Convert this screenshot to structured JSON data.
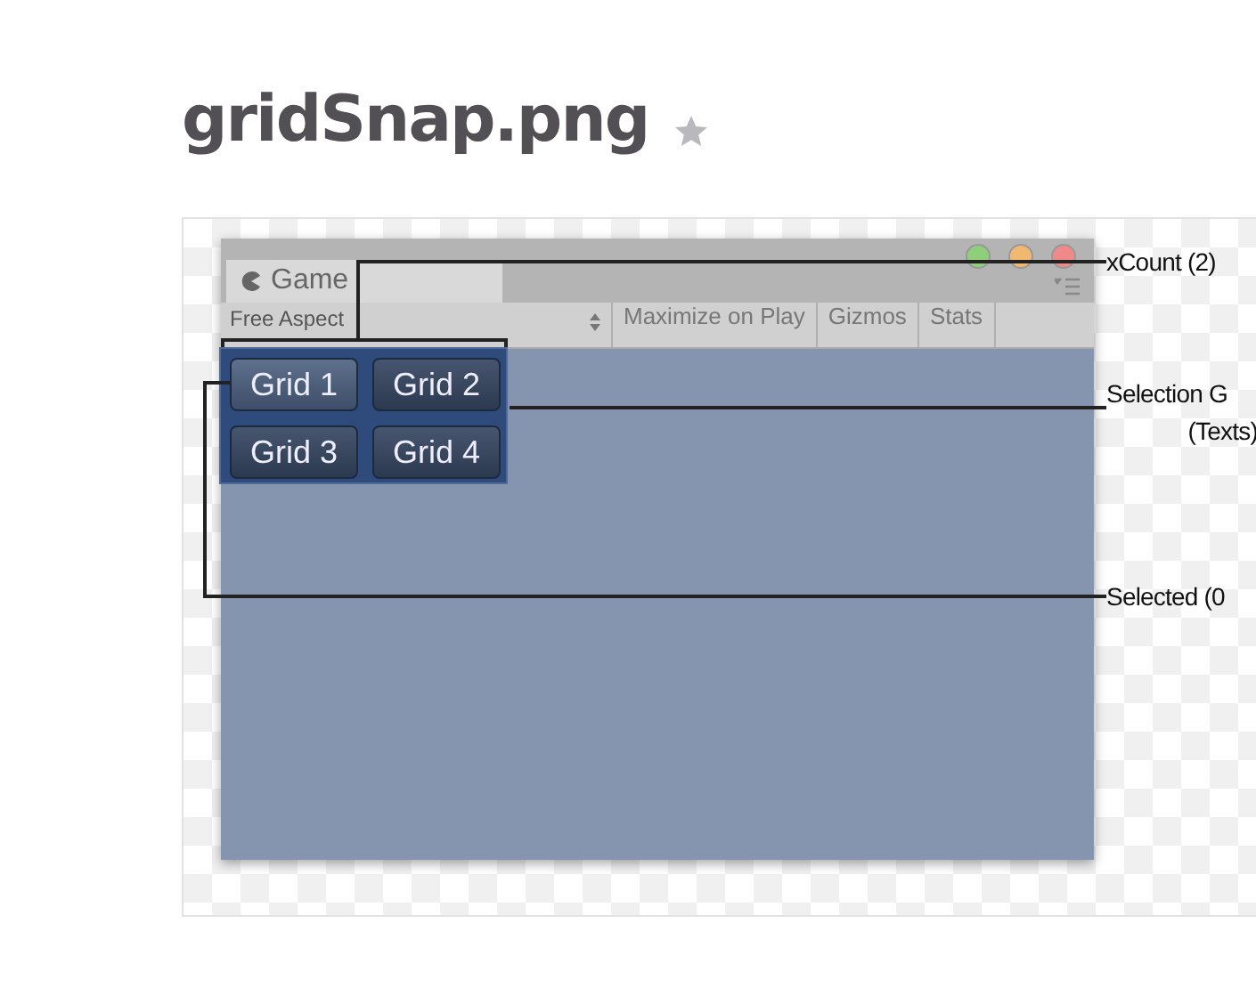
{
  "page": {
    "title": "gridSnap.png"
  },
  "image": {
    "window": {
      "tab": "Game",
      "toolbar": [
        {
          "label": "Free Aspect",
          "kind": "dropdown"
        },
        {
          "label": "Maximize on Play",
          "kind": "toggle"
        },
        {
          "label": "Gizmos",
          "kind": "toggle"
        },
        {
          "label": "Stats",
          "kind": "toggle"
        }
      ],
      "grid": [
        {
          "label": "Grid 1",
          "selected": true
        },
        {
          "label": "Grid 2",
          "selected": false
        },
        {
          "label": "Grid 3",
          "selected": false
        },
        {
          "label": "Grid 4",
          "selected": false
        }
      ]
    },
    "callouts": [
      {
        "lines": [
          "xCount (2)"
        ]
      },
      {
        "lines": [
          "Selection G",
          "(Texts)"
        ]
      },
      {
        "lines": [
          "Selected (0"
        ]
      }
    ]
  }
}
